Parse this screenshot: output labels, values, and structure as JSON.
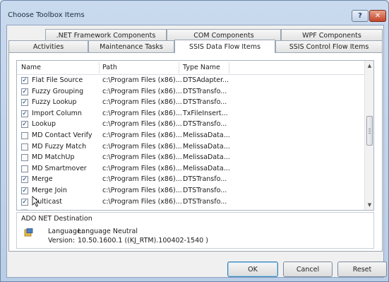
{
  "window": {
    "title": "Choose Toolbox Items",
    "help_label": "?",
    "close_label": "✕"
  },
  "tabs": {
    "row1": [
      ".NET Framework Components",
      "COM Components",
      "WPF Components"
    ],
    "row2": [
      "Activities",
      "Maintenance Tasks",
      "SSIS Data Flow Items",
      "SSIS Control Flow Items"
    ],
    "active": "SSIS Data Flow Items"
  },
  "list": {
    "columns": [
      "Name",
      "Path",
      "Type Name"
    ],
    "rows": [
      {
        "checked": true,
        "name": "Flat File Source",
        "path": "c:\\Program Files (x86)...",
        "type": "DTSAdapter..."
      },
      {
        "checked": true,
        "name": "Fuzzy Grouping",
        "path": "c:\\Program Files (x86)...",
        "type": "DTSTransfo..."
      },
      {
        "checked": true,
        "name": "Fuzzy Lookup",
        "path": "c:\\Program Files (x86)...",
        "type": "DTSTransfo..."
      },
      {
        "checked": true,
        "name": "Import Column",
        "path": "c:\\Program Files (x86)...",
        "type": "TxFileInsert..."
      },
      {
        "checked": true,
        "name": "Lookup",
        "path": "c:\\Program Files (x86)...",
        "type": "DTSTransfo..."
      },
      {
        "checked": false,
        "name": "MD Contact Verify",
        "path": "c:\\Program Files (x86)...",
        "type": "MelissaData..."
      },
      {
        "checked": false,
        "name": "MD Fuzzy Match",
        "path": "c:\\Program Files (x86)...",
        "type": "MelissaData..."
      },
      {
        "checked": false,
        "name": "MD MatchUp",
        "path": "c:\\Program Files (x86)...",
        "type": "MelissaData..."
      },
      {
        "checked": false,
        "name": "MD Smartmover",
        "path": "c:\\Program Files (x86)...",
        "type": "MelissaData..."
      },
      {
        "checked": true,
        "name": "Merge",
        "path": "c:\\Program Files (x86)...",
        "type": "DTSTransfo..."
      },
      {
        "checked": true,
        "name": "Merge Join",
        "path": "c:\\Program Files (x86)...",
        "type": "DTSTransfo..."
      },
      {
        "checked": true,
        "name": "Multicast",
        "path": "c:\\Program Files (x86)...",
        "type": "DTSTransfo..."
      }
    ]
  },
  "details": {
    "title": "ADO NET Destination",
    "language_label": "Language:",
    "language_value": "Language Neutral",
    "version_label": "Version:",
    "version_value": "10.50.1600.1 ((KJ_RTM).100402-1540 )"
  },
  "buttons": {
    "ok": "OK",
    "cancel": "Cancel",
    "reset": "Reset"
  },
  "scrollbar": {
    "up": "▲",
    "down": "▼"
  }
}
